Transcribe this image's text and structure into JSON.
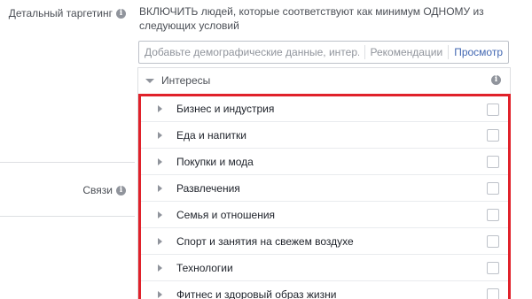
{
  "labels": {
    "detailed_targeting": "Детальный таргетинг",
    "connections": "Связи"
  },
  "instruction": "ВКЛЮЧИТЬ людей, которые соответствуют как минимум ОДНОМУ из следующих условий",
  "search": {
    "placeholder": "Добавьте демографические данные, интер...",
    "recommendations_label": "Рекомендации",
    "browse_label": "Просмотр"
  },
  "dropdown": {
    "header": "Интересы",
    "items": [
      {
        "label": "Бизнес и индустрия",
        "checked": false
      },
      {
        "label": "Еда и напитки",
        "checked": false
      },
      {
        "label": "Покупки и мода",
        "checked": false
      },
      {
        "label": "Развлечения",
        "checked": false
      },
      {
        "label": "Семья и отношения",
        "checked": false
      },
      {
        "label": "Спорт и занятия на свежем воздухе",
        "checked": false
      },
      {
        "label": "Технологии",
        "checked": false
      },
      {
        "label": "Фитнес и здоровый образ жизни",
        "checked": false
      }
    ]
  },
  "colors": {
    "highlight_border": "#e0212a",
    "link": "#4267b2"
  }
}
